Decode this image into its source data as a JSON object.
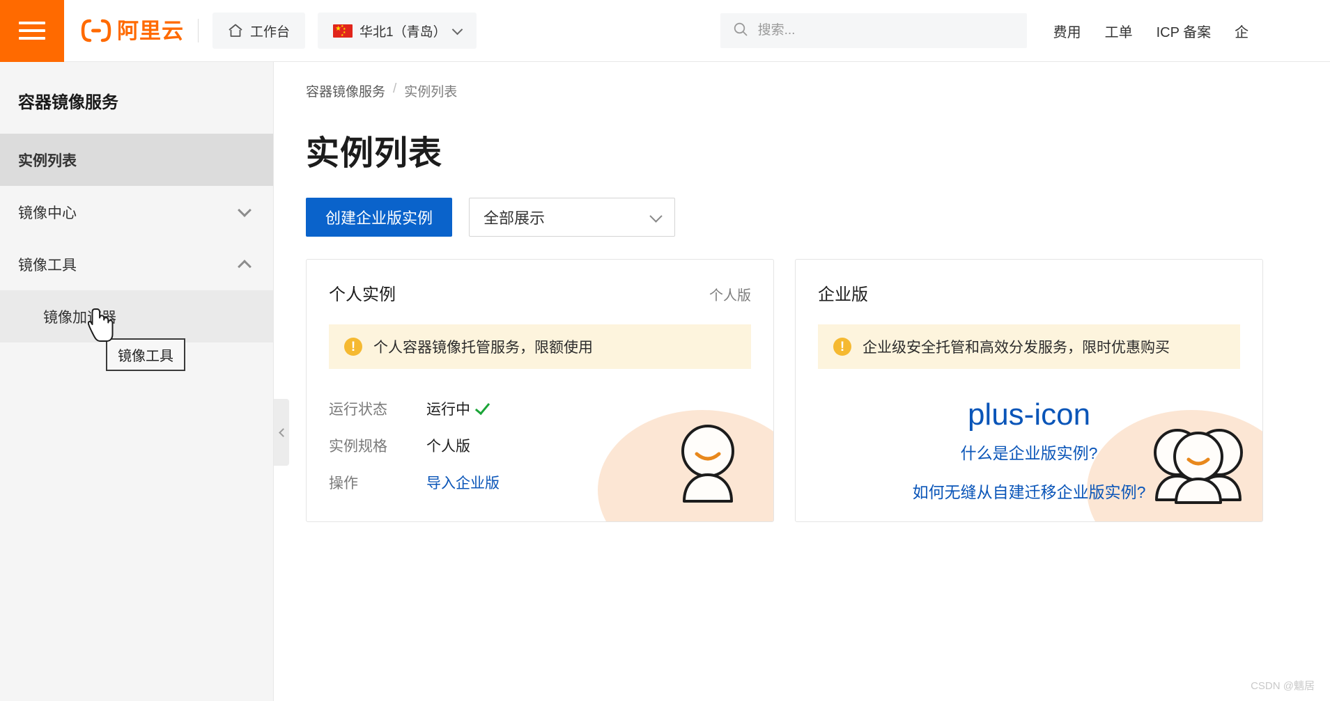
{
  "header": {
    "menu_icon": "hamburger-icon",
    "logo_text": "阿里云",
    "workbench": {
      "label": "工作台",
      "icon": "home-icon"
    },
    "region": {
      "label": "华北1（青岛）",
      "flag": "cn-flag-icon",
      "chevron": "chevron-down-icon"
    },
    "search": {
      "placeholder": "搜索...",
      "value": "",
      "icon": "search-icon"
    },
    "nav": [
      {
        "label": "费用"
      },
      {
        "label": "工单"
      },
      {
        "label": "ICP 备案"
      },
      {
        "label": "企"
      }
    ]
  },
  "sidebar": {
    "title": "容器镜像服务",
    "items": [
      {
        "label": "实例列表",
        "active": true,
        "arrow": ""
      },
      {
        "label": "镜像中心",
        "active": false,
        "arrow": "chevron-down-icon"
      },
      {
        "label": "镜像工具",
        "active": false,
        "arrow": "chevron-up-icon"
      },
      {
        "label": "镜像加速器",
        "active": false,
        "sub": true,
        "arrow": ""
      }
    ],
    "tooltip": "镜像工具",
    "collapse_icon": "chevron-left-icon"
  },
  "main": {
    "breadcrumb": {
      "root": "容器镜像服务",
      "separator": "/",
      "current": "实例列表"
    },
    "page_title": "实例列表",
    "toolbar": {
      "create_button": "创建企业版实例",
      "filter_value": "全部展示",
      "filter_chevron": "chevron-down-icon"
    },
    "cards": [
      {
        "title": "个人实例",
        "tag": "个人版",
        "notice": "个人容器镜像托管服务，限额使用",
        "notice_icon": "warning-icon",
        "rows": [
          {
            "label": "运行状态",
            "value": "运行中",
            "status_icon": "check-icon"
          },
          {
            "label": "实例规格",
            "value": "个人版"
          },
          {
            "label": "操作",
            "value": "导入企业版",
            "link": true
          }
        ],
        "illustration": "single-person-icon"
      },
      {
        "title": "企业版",
        "tag": "",
        "notice": "企业级安全托管和高效分发服务，限时优惠购买",
        "notice_icon": "warning-icon",
        "plus_icon": "plus-icon",
        "links": [
          "什么是企业版实例?",
          "如何无缝从自建迁移企业版实例?"
        ],
        "illustration": "group-person-icon"
      }
    ]
  },
  "watermark": "CSDN @魑居",
  "colors": {
    "brand_orange": "#ff6a00",
    "primary_blue": "#0a63cb",
    "link_blue": "#0a55b8",
    "notice_bg": "#fdf4dd",
    "warn": "#f5b931",
    "success_green": "#1aa437",
    "sidebar_bg": "#f5f5f5"
  }
}
